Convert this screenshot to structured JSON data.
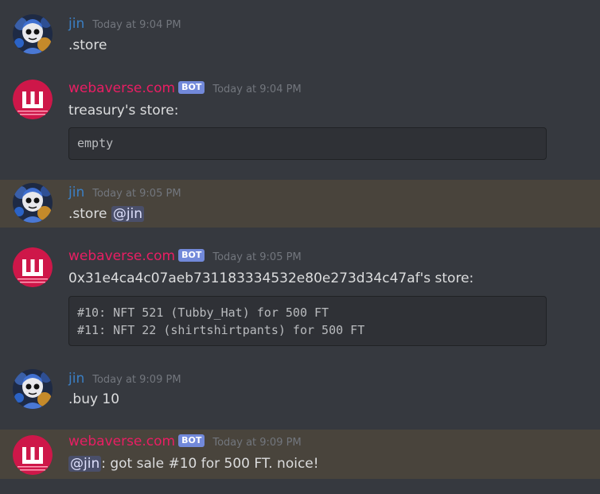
{
  "users": {
    "jin": {
      "name": "jin"
    },
    "bot": {
      "name": "webaverse.com",
      "badge": "BOT"
    }
  },
  "messages": [
    {
      "author": "jin",
      "time": "Today at 9:04 PM",
      "text": ".store"
    },
    {
      "author": "webaverse.com",
      "time": "Today at 9:04 PM",
      "text": "treasury's store:",
      "code": [
        "empty"
      ]
    },
    {
      "author": "jin",
      "time": "Today at 9:05 PM",
      "text_prefix": ".store ",
      "mention": "@jin"
    },
    {
      "author": "webaverse.com",
      "time": "Today at 9:05 PM",
      "text": "0x31e4ca4c07aeb731183334532e80e273d34c47af's store:",
      "code": [
        "#10: NFT 521 (Tubby_Hat) for 500 FT",
        "#11: NFT 22 (shirtshirtpants) for 500 FT"
      ]
    },
    {
      "author": "jin",
      "time": "Today at 9:09 PM",
      "text": ".buy 10"
    },
    {
      "author": "webaverse.com",
      "time": "Today at 9:09 PM",
      "mention": "@jin",
      "text_suffix": ": got sale #10 for 500 FT. noice!"
    }
  ]
}
